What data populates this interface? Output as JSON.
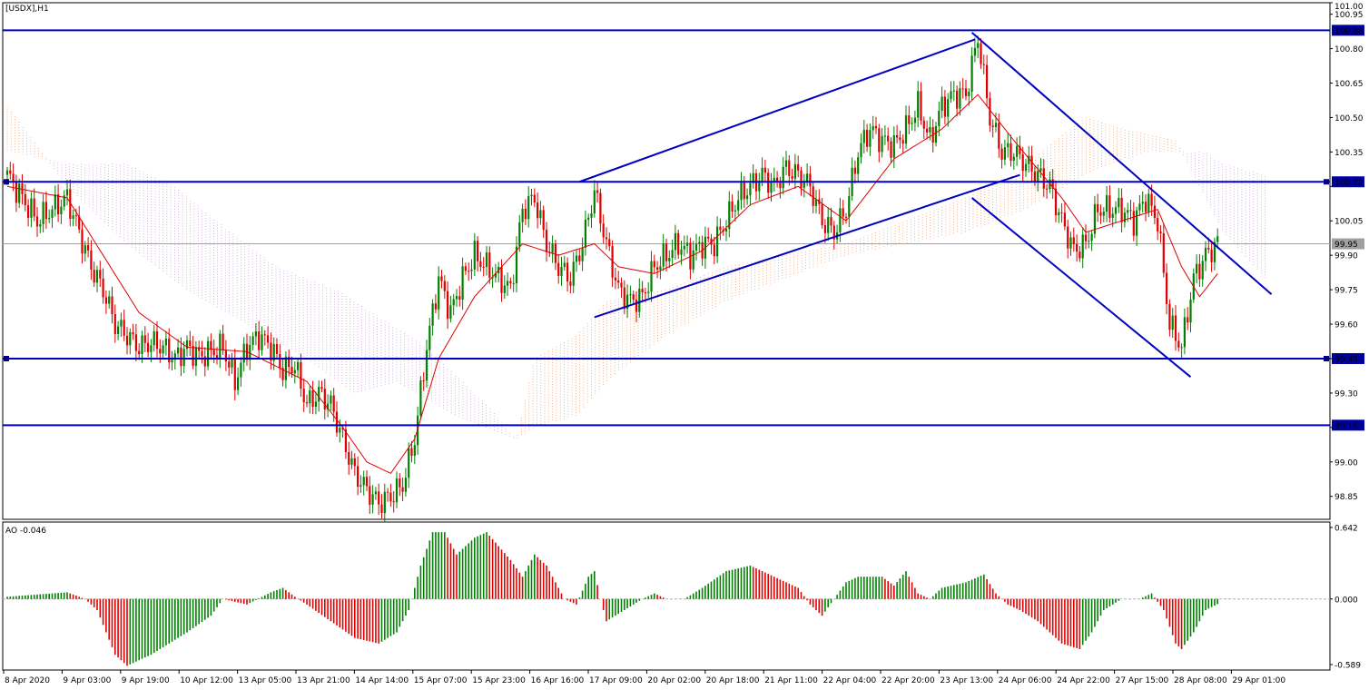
{
  "window_title": "[USDX],H1",
  "ao_label": "AO -0.046",
  "colors": {
    "bull": "#008000",
    "bear": "#e00000",
    "trend": "#0000c0",
    "ma": "#e00000",
    "cloud_a": "#f0a070",
    "cloud_b": "#c8a0d8",
    "current": "#a0a0a0",
    "zero_line": "#b0b0b0"
  },
  "chart_data": [
    {
      "type": "candlestick",
      "symbol": "USDX",
      "timeframe": "H1",
      "ylim": [
        98.75,
        101.0
      ],
      "y_ticks": [
        "101.00",
        "100.95",
        "100.80",
        "100.65",
        "100.50",
        "100.35",
        "100.20",
        "100.05",
        "99.90",
        "99.75",
        "99.60",
        "99.45",
        "99.30",
        "99.15",
        "99.00",
        "98.85"
      ],
      "x_ticks": [
        "8 Apr 2020",
        "9 Apr 03:00",
        "9 Apr 19:00",
        "10 Apr 12:00",
        "13 Apr 05:00",
        "13 Apr 21:00",
        "14 Apr 14:00",
        "15 Apr 07:00",
        "15 Apr 23:00",
        "16 Apr 16:00",
        "17 Apr 09:00",
        "20 Apr 02:00",
        "20 Apr 18:00",
        "21 Apr 11:00",
        "22 Apr 04:00",
        "22 Apr 20:00",
        "23 Apr 13:00",
        "24 Apr 06:00",
        "24 Apr 22:00",
        "27 Apr 15:00",
        "28 Apr 08:00",
        "29 Apr 01:00"
      ],
      "close_anchors": [
        [
          0,
          100.25
        ],
        [
          5,
          100.15
        ],
        [
          10,
          100.05
        ],
        [
          15,
          100.1
        ],
        [
          20,
          100.15
        ],
        [
          24,
          100.0
        ],
        [
          28,
          99.85
        ],
        [
          32,
          99.75
        ],
        [
          36,
          99.6
        ],
        [
          40,
          99.55
        ],
        [
          44,
          99.5
        ],
        [
          48,
          99.52
        ],
        [
          52,
          99.5
        ],
        [
          56,
          99.45
        ],
        [
          60,
          99.5
        ],
        [
          64,
          99.46
        ],
        [
          68,
          99.48
        ],
        [
          72,
          99.5
        ],
        [
          76,
          99.35
        ],
        [
          80,
          99.5
        ],
        [
          84,
          99.55
        ],
        [
          88,
          99.5
        ],
        [
          92,
          99.4
        ],
        [
          96,
          99.42
        ],
        [
          100,
          99.25
        ],
        [
          104,
          99.3
        ],
        [
          108,
          99.25
        ],
        [
          112,
          99.1
        ],
        [
          116,
          98.95
        ],
        [
          120,
          98.88
        ],
        [
          124,
          98.82
        ],
        [
          128,
          98.85
        ],
        [
          132,
          98.9
        ],
        [
          136,
          99.1
        ],
        [
          140,
          99.5
        ],
        [
          144,
          99.8
        ],
        [
          148,
          99.65
        ],
        [
          152,
          99.8
        ],
        [
          156,
          99.9
        ],
        [
          160,
          99.85
        ],
        [
          164,
          99.8
        ],
        [
          168,
          99.75
        ],
        [
          172,
          100.1
        ],
        [
          176,
          100.15
        ],
        [
          180,
          99.95
        ],
        [
          184,
          99.85
        ],
        [
          188,
          99.8
        ],
        [
          192,
          99.95
        ],
        [
          196,
          100.18
        ],
        [
          200,
          99.95
        ],
        [
          204,
          99.75
        ],
        [
          208,
          99.7
        ],
        [
          212,
          99.72
        ],
        [
          216,
          99.85
        ],
        [
          220,
          99.9
        ],
        [
          224,
          99.95
        ],
        [
          228,
          99.9
        ],
        [
          232,
          99.95
        ],
        [
          236,
          99.95
        ],
        [
          240,
          100.05
        ],
        [
          244,
          100.15
        ],
        [
          248,
          100.2
        ],
        [
          252,
          100.25
        ],
        [
          256,
          100.2
        ],
        [
          260,
          100.28
        ],
        [
          264,
          100.25
        ],
        [
          268,
          100.2
        ],
        [
          272,
          100.05
        ],
        [
          276,
          100.0
        ],
        [
          280,
          100.1
        ],
        [
          284,
          100.35
        ],
        [
          288,
          100.45
        ],
        [
          292,
          100.4
        ],
        [
          296,
          100.38
        ],
        [
          300,
          100.45
        ],
        [
          304,
          100.55
        ],
        [
          308,
          100.4
        ],
        [
          312,
          100.55
        ],
        [
          316,
          100.6
        ],
        [
          320,
          100.6
        ],
        [
          324,
          100.85
        ],
        [
          328,
          100.5
        ],
        [
          332,
          100.35
        ],
        [
          336,
          100.35
        ],
        [
          340,
          100.3
        ],
        [
          344,
          100.25
        ],
        [
          348,
          100.2
        ],
        [
          352,
          100.05
        ],
        [
          356,
          99.92
        ],
        [
          360,
          99.95
        ],
        [
          364,
          100.1
        ],
        [
          368,
          100.1
        ],
        [
          372,
          100.1
        ],
        [
          376,
          100.05
        ],
        [
          380,
          100.15
        ],
        [
          384,
          100.05
        ],
        [
          388,
          99.6
        ],
        [
          392,
          99.5
        ],
        [
          396,
          99.8
        ],
        [
          400,
          99.9
        ],
        [
          404,
          99.95
        ]
      ],
      "ma_anchors": [
        [
          0,
          100.2
        ],
        [
          20,
          100.15
        ],
        [
          32,
          99.9
        ],
        [
          44,
          99.65
        ],
        [
          60,
          99.5
        ],
        [
          80,
          99.48
        ],
        [
          100,
          99.35
        ],
        [
          112,
          99.15
        ],
        [
          120,
          99.0
        ],
        [
          128,
          98.95
        ],
        [
          136,
          99.1
        ],
        [
          144,
          99.45
        ],
        [
          156,
          99.72
        ],
        [
          172,
          99.95
        ],
        [
          184,
          99.9
        ],
        [
          196,
          99.95
        ],
        [
          204,
          99.85
        ],
        [
          216,
          99.82
        ],
        [
          232,
          99.92
        ],
        [
          248,
          100.12
        ],
        [
          264,
          100.2
        ],
        [
          280,
          100.05
        ],
        [
          296,
          100.32
        ],
        [
          312,
          100.45
        ],
        [
          324,
          100.6
        ],
        [
          336,
          100.4
        ],
        [
          352,
          100.15
        ],
        [
          360,
          100.0
        ],
        [
          372,
          100.05
        ],
        [
          384,
          100.1
        ],
        [
          392,
          99.85
        ],
        [
          398,
          99.72
        ],
        [
          404,
          99.82
        ]
      ],
      "cloud_a_anchors": [
        [
          0,
          100.55
        ],
        [
          20,
          100.2
        ],
        [
          40,
          99.95
        ],
        [
          60,
          99.75
        ],
        [
          80,
          99.6
        ],
        [
          100,
          99.45
        ],
        [
          116,
          99.3
        ],
        [
          130,
          99.35
        ],
        [
          150,
          99.2
        ],
        [
          170,
          99.1
        ],
        [
          176,
          99.45
        ],
        [
          190,
          99.55
        ],
        [
          200,
          99.7
        ],
        [
          220,
          99.75
        ],
        [
          240,
          99.85
        ],
        [
          260,
          99.9
        ],
        [
          280,
          99.95
        ],
        [
          300,
          100.05
        ],
        [
          320,
          100.15
        ],
        [
          336,
          100.25
        ],
        [
          350,
          100.4
        ],
        [
          360,
          100.5
        ],
        [
          372,
          100.45
        ],
        [
          390,
          100.4
        ],
        [
          406,
          100.0
        ],
        [
          420,
          99.8
        ]
      ],
      "cloud_b_anchors": [
        [
          0,
          100.35
        ],
        [
          20,
          100.3
        ],
        [
          40,
          100.3
        ],
        [
          56,
          100.2
        ],
        [
          70,
          100.05
        ],
        [
          90,
          99.85
        ],
        [
          110,
          99.75
        ],
        [
          128,
          99.6
        ],
        [
          140,
          99.5
        ],
        [
          160,
          99.25
        ],
        [
          170,
          99.1
        ],
        [
          176,
          99.15
        ],
        [
          190,
          99.2
        ],
        [
          200,
          99.35
        ],
        [
          220,
          99.55
        ],
        [
          240,
          99.7
        ],
        [
          260,
          99.8
        ],
        [
          280,
          99.9
        ],
        [
          300,
          99.95
        ],
        [
          320,
          100.0
        ],
        [
          340,
          100.1
        ],
        [
          360,
          100.25
        ],
        [
          380,
          100.35
        ],
        [
          400,
          100.35
        ],
        [
          406,
          100.3
        ],
        [
          420,
          100.25
        ]
      ],
      "horizontal_levels": [
        {
          "value": 100.88,
          "label": "100.88"
        },
        {
          "value": 100.22,
          "label": "100.22"
        },
        {
          "value": 99.45,
          "label": "99.45"
        },
        {
          "value": 99.16,
          "label": "99.16"
        }
      ],
      "current_price": {
        "value": 99.95,
        "label": "99.95"
      },
      "trend_lines": [
        {
          "from": [
            191,
            100.22
          ],
          "to": [
            323,
            100.84
          ]
        },
        {
          "from": [
            196,
            99.63
          ],
          "to": [
            338,
            100.25
          ]
        },
        {
          "from": [
            322,
            100.87
          ],
          "to": [
            422,
            99.73
          ]
        },
        {
          "from": [
            322,
            100.15
          ],
          "to": [
            395,
            99.37
          ]
        }
      ]
    },
    {
      "type": "bar",
      "name": "AO",
      "value_label": "-0.046",
      "ylim": [
        -0.589,
        0.642
      ],
      "y_ticks": [
        "0.642",
        "0.000",
        "-0.589"
      ],
      "value_anchors": [
        [
          0,
          0.02
        ],
        [
          10,
          0.04
        ],
        [
          20,
          0.06
        ],
        [
          26,
          0.0
        ],
        [
          30,
          -0.1
        ],
        [
          36,
          -0.5
        ],
        [
          40,
          -0.6
        ],
        [
          48,
          -0.5
        ],
        [
          60,
          -0.3
        ],
        [
          68,
          -0.15
        ],
        [
          72,
          0.0
        ],
        [
          80,
          -0.05
        ],
        [
          88,
          0.06
        ],
        [
          92,
          0.1
        ],
        [
          96,
          0.02
        ],
        [
          100,
          -0.05
        ],
        [
          108,
          -0.2
        ],
        [
          116,
          -0.35
        ],
        [
          124,
          -0.4
        ],
        [
          130,
          -0.3
        ],
        [
          134,
          -0.1
        ],
        [
          138,
          0.3
        ],
        [
          142,
          0.6
        ],
        [
          146,
          0.6
        ],
        [
          150,
          0.4
        ],
        [
          156,
          0.55
        ],
        [
          160,
          0.6
        ],
        [
          168,
          0.35
        ],
        [
          172,
          0.2
        ],
        [
          176,
          0.4
        ],
        [
          180,
          0.3
        ],
        [
          186,
          0.0
        ],
        [
          190,
          -0.05
        ],
        [
          194,
          0.2
        ],
        [
          196,
          0.25
        ],
        [
          198,
          0.0
        ],
        [
          200,
          -0.2
        ],
        [
          206,
          -0.1
        ],
        [
          212,
          0.0
        ],
        [
          216,
          0.05
        ],
        [
          220,
          0.0
        ],
        [
          226,
          0.0
        ],
        [
          232,
          0.1
        ],
        [
          240,
          0.25
        ],
        [
          248,
          0.3
        ],
        [
          256,
          0.2
        ],
        [
          264,
          0.1
        ],
        [
          268,
          -0.05
        ],
        [
          272,
          -0.15
        ],
        [
          276,
          0.0
        ],
        [
          280,
          0.15
        ],
        [
          284,
          0.2
        ],
        [
          292,
          0.2
        ],
        [
          296,
          0.12
        ],
        [
          300,
          0.25
        ],
        [
          304,
          0.05
        ],
        [
          308,
          0.0
        ],
        [
          312,
          0.1
        ],
        [
          320,
          0.15
        ],
        [
          326,
          0.22
        ],
        [
          330,
          0.05
        ],
        [
          334,
          -0.05
        ],
        [
          338,
          -0.1
        ],
        [
          344,
          -0.2
        ],
        [
          352,
          -0.4
        ],
        [
          358,
          -0.45
        ],
        [
          362,
          -0.3
        ],
        [
          366,
          -0.1
        ],
        [
          372,
          0.0
        ],
        [
          378,
          0.0
        ],
        [
          382,
          0.05
        ],
        [
          386,
          -0.1
        ],
        [
          390,
          -0.4
        ],
        [
          392,
          -0.45
        ],
        [
          396,
          -0.3
        ],
        [
          400,
          -0.1
        ],
        [
          404,
          -0.046
        ]
      ]
    }
  ]
}
